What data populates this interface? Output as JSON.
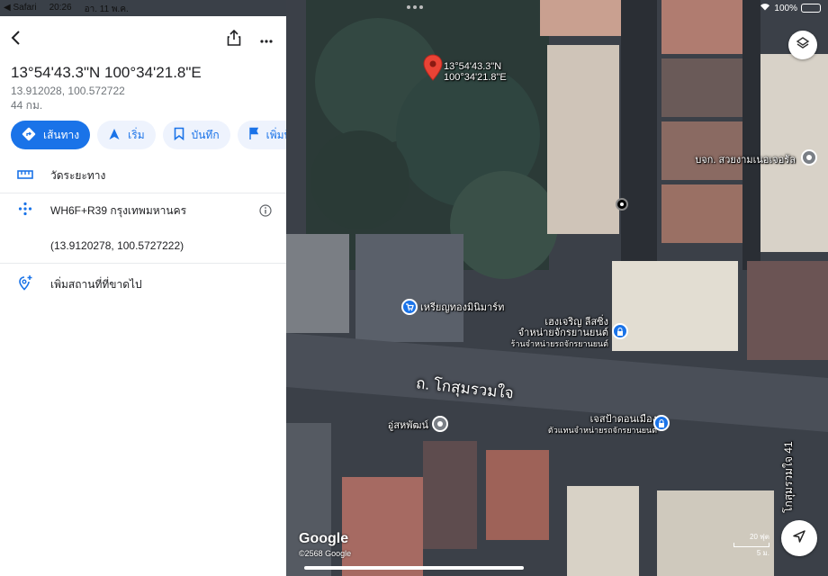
{
  "status": {
    "app": "◀ Safari",
    "time": "20:26",
    "date": "อา. 11 พ.ค.",
    "battery": "100%",
    "battery_level": 1.0
  },
  "place": {
    "title": "13°54'43.3\"N 100°34'21.8\"E",
    "decimal": "13.912028, 100.572722",
    "distance": "44 กม."
  },
  "chips": [
    {
      "label": "เส้นทาง",
      "icon": "directions-icon",
      "primary": true
    },
    {
      "label": "เริ่ม",
      "icon": "navigation-arrow-icon",
      "primary": false
    },
    {
      "label": "บันทึก",
      "icon": "bookmark-icon",
      "primary": false
    },
    {
      "label": "เพิ่มป้าย",
      "icon": "flag-icon",
      "primary": false
    }
  ],
  "rows": {
    "measure": "วัดระยะทาง",
    "pluscode": "WH6F+R39 กรุงเทพมหานคร",
    "coords": "(13.9120278, 100.5727222)",
    "add_place": "เพิ่มสถานที่ที่ขาดไป"
  },
  "map": {
    "pin_label_line1": "13°54'43.3\"N",
    "pin_label_line2": "100°34'21.8\"E",
    "road": "ถ. โกสุมรวมใจ",
    "side_road": "โกสุมรวมใจ 41",
    "pois": {
      "biz1": "บจก. สวยงามเนอเจอรัล",
      "shop": "เหรียญทองมินิมาร์ท",
      "car1_line1": "เฮงเจริญ ลีสซิ่ง",
      "car1_line2": "จำหน่ายจักรยานยนต์",
      "car1_line3": "ร้านจำหน่ายรถจักรยานยนต์",
      "garage": "อู่สหพัฒน์",
      "car2_line1": "เจสป้าดอนเมือง",
      "car2_line2": "ตัวแทนจำหน่ายรถจักรยานยนต์"
    },
    "logo": "Google",
    "copyright": "©2568 Google",
    "scale_top": "20 ฟุต",
    "scale_bottom": "5 ม."
  }
}
